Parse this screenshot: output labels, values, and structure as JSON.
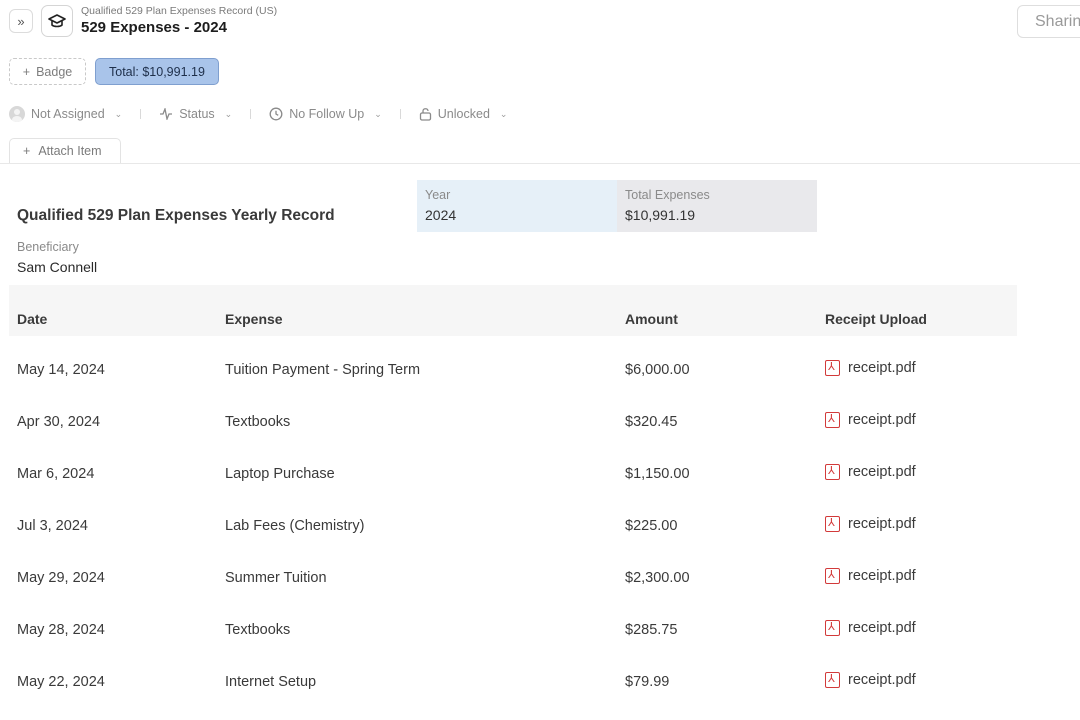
{
  "header": {
    "breadcrumb": "Qualified 529 Plan Expenses Record (US)",
    "title": "529 Expenses - 2024",
    "expand_glyph": "»",
    "share_label": "Sharing"
  },
  "badges": {
    "add_label": "Badge",
    "total_label": "Total: $10,991.19"
  },
  "meta": {
    "assignee": "Not Assigned",
    "status": "Status",
    "follow_up": "No Follow Up",
    "lock": "Unlocked"
  },
  "attach": {
    "label": "Attach Item"
  },
  "record": {
    "title": "Qualified 529 Plan Expenses Yearly Record",
    "year_label": "Year",
    "year_value": "2024",
    "total_label": "Total Expenses",
    "total_value": "$10,991.19",
    "beneficiary_label": "Beneficiary",
    "beneficiary_value": "Sam Connell"
  },
  "table": {
    "columns": [
      "Date",
      "Expense",
      "Amount",
      "Receipt Upload"
    ],
    "rows": [
      {
        "date": "May 14, 2024",
        "expense": "Tuition Payment - Spring Term",
        "amount": "$6,000.00",
        "receipt": "receipt.pdf"
      },
      {
        "date": "Apr 30, 2024",
        "expense": "Textbooks",
        "amount": "$320.45",
        "receipt": "receipt.pdf"
      },
      {
        "date": "Mar 6, 2024",
        "expense": "Laptop Purchase",
        "amount": "$1,150.00",
        "receipt": "receipt.pdf"
      },
      {
        "date": "Jul 3, 2024",
        "expense": "Lab Fees (Chemistry)",
        "amount": "$225.00",
        "receipt": "receipt.pdf"
      },
      {
        "date": "May 29, 2024",
        "expense": "Summer Tuition",
        "amount": "$2,300.00",
        "receipt": "receipt.pdf"
      },
      {
        "date": "May 28, 2024",
        "expense": "Textbooks",
        "amount": "$285.75",
        "receipt": "receipt.pdf"
      },
      {
        "date": "May 22, 2024",
        "expense": "Internet Setup",
        "amount": "$79.99",
        "receipt": "receipt.pdf"
      }
    ]
  },
  "colors": {
    "total_badge_bg": "#a9c4ea",
    "year_box_bg": "#e6f0f8",
    "total_box_bg": "#e9e9ec",
    "pdf_icon": "#d23a3a"
  }
}
